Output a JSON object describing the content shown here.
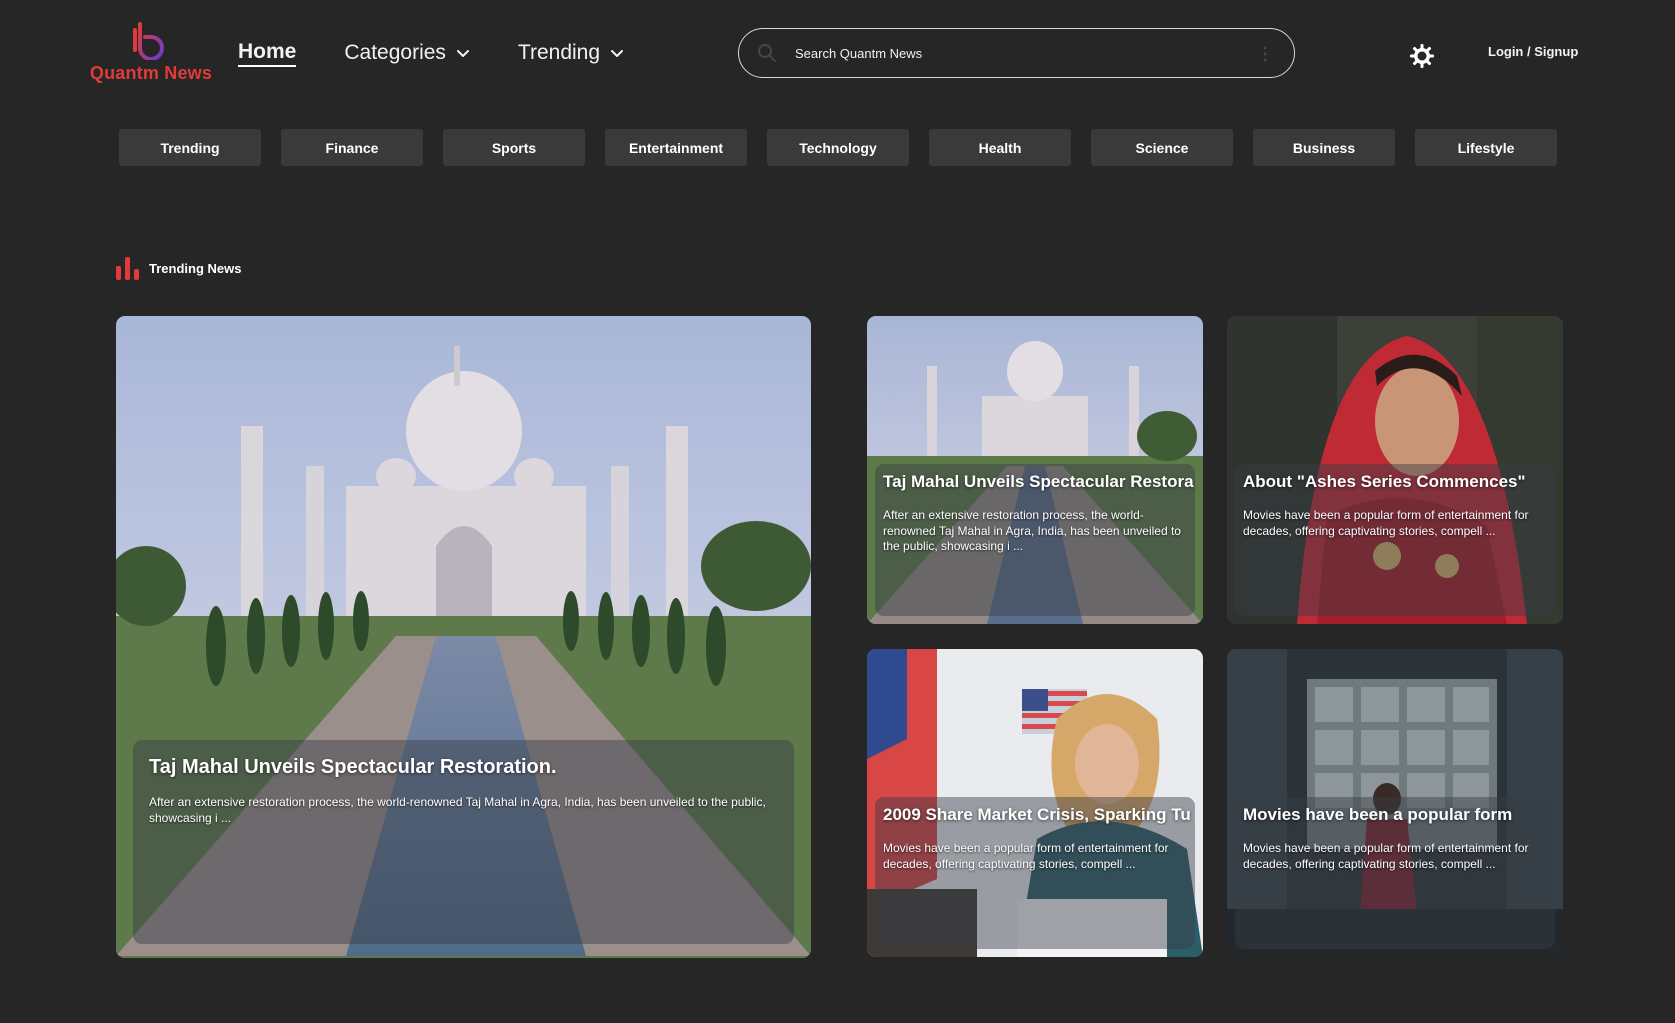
{
  "brand": {
    "name": "Quantm News",
    "accent": "#e23a3a"
  },
  "nav": {
    "home": "Home",
    "categories": "Categories",
    "trending": "Trending"
  },
  "search": {
    "placeholder": "Search Quantm News"
  },
  "auth": {
    "login_label": "Login / Signup"
  },
  "chips": [
    "Trending",
    "Finance",
    "Sports",
    "Entertainment",
    "Technology",
    "Health",
    "Science",
    "Business",
    "Lifestyle"
  ],
  "section": {
    "title": "Trending News"
  },
  "cards": [
    {
      "title": "Taj Mahal Unveils Spectacular Restoration.",
      "desc": "After an extensive restoration process, the world-renowned Taj Mahal in Agra, India, has been unveiled to the public, showcasing i ..."
    },
    {
      "title": "Taj Mahal Unveils Spectacular Restora",
      "desc": "After an extensive restoration process, the world-renowned Taj Mahal in Agra, India, has been unveiled to the public, showcasing i ..."
    },
    {
      "title": "About \"Ashes Series Commences\"",
      "desc": "Movies have been a popular form of entertainment for decades, offering captivating stories, compell ..."
    },
    {
      "title": "2009 Share Market Crisis, Sparking Tu",
      "desc": "Movies have been a popular form of entertainment for decades, offering captivating stories, compell ..."
    },
    {
      "title": "Movies have been a popular form",
      "desc": "Movies have been a popular form of entertainment for decades, offering captivating stories, compell ..."
    }
  ],
  "colors": {
    "background": "#262626",
    "chip": "#3a3a3a"
  }
}
